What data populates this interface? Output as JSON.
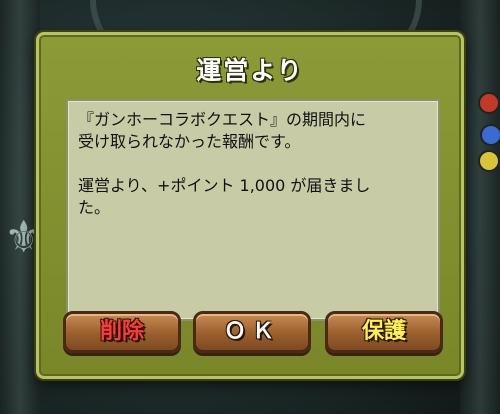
{
  "dialog": {
    "title": "運営より",
    "message_lines": [
      "『ガンホーコラボクエスト』の期間内に",
      "受け取られなかった報酬です。",
      "",
      "運営より、+ポイント 1,000 が届きまし",
      "た。"
    ],
    "buttons": {
      "delete_label": "削除",
      "ok_label": "ＯＫ",
      "protect_label": "保護"
    }
  },
  "colors": {
    "dialog_bg": "#85932f",
    "message_bg": "#c7cca6",
    "button_bg": "#9a5f2e",
    "delete_text": "#ff3b3b",
    "ok_text": "#ffffff",
    "protect_text": "#ffef5a"
  }
}
